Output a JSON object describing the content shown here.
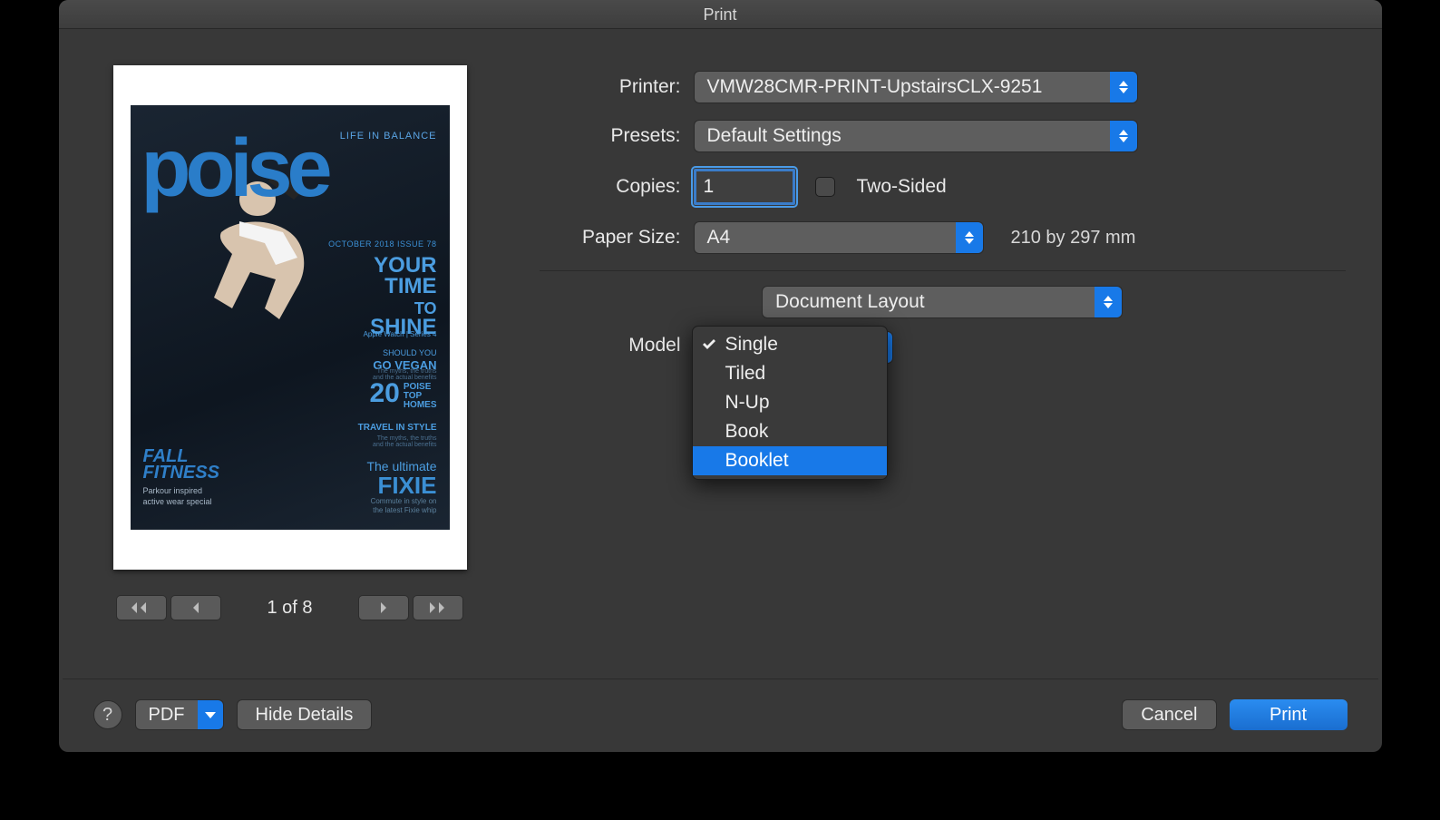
{
  "window": {
    "title": "Print"
  },
  "preview": {
    "page_indicator": "1 of 8",
    "magazine": {
      "tagline": "LIFE IN BALANCE",
      "brand": "poise",
      "issue": "OCTOBER 2018 ISSUE 78",
      "headline_l1": "YOUR",
      "headline_l2": "TIME",
      "headline_l3": "TO",
      "headline_l4": "SHINE",
      "sub_watch": "Apple Watch | Series 4",
      "vegan_l1": "SHOULD YOU",
      "vegan_l2": "GO VEGAN",
      "vegan_l3": "The myths, the truths",
      "vegan_l4": "and the actual benefits",
      "twenty_num": "20",
      "twenty_l1": "POISE",
      "twenty_l2": "TOP",
      "twenty_l3": "HOMES",
      "travel_l1": "TRAVEL IN",
      "travel_l2": "STYLE",
      "travel_l3": "The myths, the truths",
      "travel_l4": "and the actual benefits",
      "ultimate": "The ultimate",
      "fixie": "FIXIE",
      "commute_l1": "Commute in style on",
      "commute_l2": "the latest Fixie whip",
      "fall_l1": "FALL",
      "fall_l2": "FITNESS",
      "parkour_l1": "Parkour inspired",
      "parkour_l2": "active wear special"
    }
  },
  "form": {
    "printer_label": "Printer:",
    "printer_value": "VMW28CMR-PRINT-UpstairsCLX-9251",
    "presets_label": "Presets:",
    "presets_value": "Default Settings",
    "copies_label": "Copies:",
    "copies_value": "1",
    "twosided_label": "Two-Sided",
    "papersize_label": "Paper Size:",
    "papersize_value": "A4",
    "papersize_dim": "210 by 297 mm",
    "section_value": "Document Layout",
    "model_label": "Model",
    "model_options": [
      "Single",
      "Tiled",
      "N-Up",
      "Book",
      "Booklet"
    ],
    "model_checked": "Single",
    "model_highlighted": "Booklet"
  },
  "footer": {
    "pdf_label": "PDF",
    "hide_details": "Hide Details",
    "cancel": "Cancel",
    "print": "Print"
  }
}
